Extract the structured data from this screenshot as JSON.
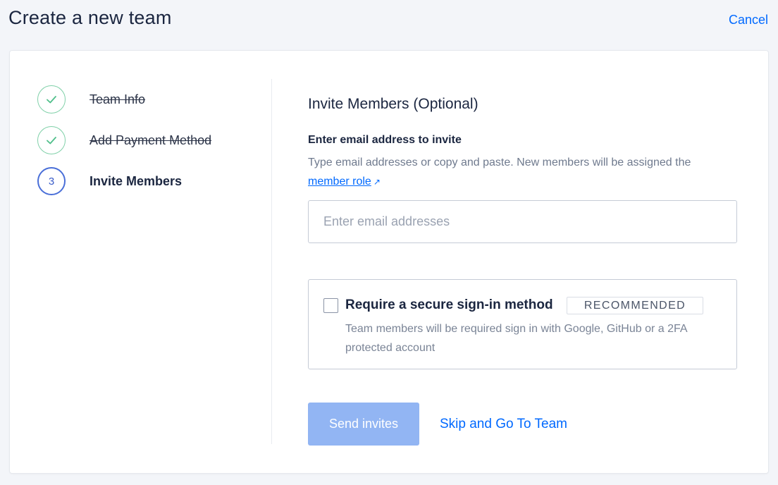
{
  "header": {
    "title": "Create a new team",
    "cancel_label": "Cancel"
  },
  "steps": [
    {
      "label": "Team Info",
      "status": "done",
      "icon": "check-icon"
    },
    {
      "label": "Add Payment Method",
      "status": "done",
      "icon": "check-icon"
    },
    {
      "label": "Invite Members",
      "status": "current",
      "number": "3"
    }
  ],
  "invite": {
    "title": "Invite Members (Optional)",
    "field_label": "Enter email address to invite",
    "helper_text": "Type email addresses or copy and paste. New members will be assigned the",
    "member_role_link": "member role",
    "email_placeholder": "Enter email addresses"
  },
  "secure_signin": {
    "label": "Require a secure sign-in method",
    "badge": "RECOMMENDED",
    "description": "Team members will be required sign in with Google, GitHub or a 2FA protected account",
    "checked": false
  },
  "actions": {
    "send_label": "Send invites",
    "skip_label": "Skip and Go To Team"
  },
  "colors": {
    "accent": "#0069ff",
    "success": "#7fd0a8",
    "disabled_button": "#92b5f3"
  }
}
